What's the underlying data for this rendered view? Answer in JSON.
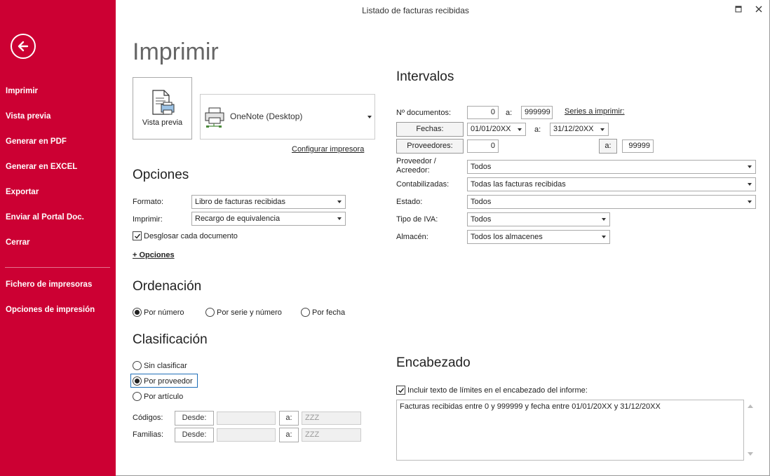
{
  "window": {
    "title": "Listado de facturas recibidas"
  },
  "sidebar": {
    "items": [
      {
        "label": "Imprimir"
      },
      {
        "label": "Vista previa"
      },
      {
        "label": "Generar en PDF"
      },
      {
        "label": "Generar en EXCEL"
      },
      {
        "label": "Exportar"
      },
      {
        "label": "Enviar al Portal Doc."
      },
      {
        "label": "Cerrar"
      },
      {
        "label": "Fichero de impresoras"
      },
      {
        "label": "Opciones de impresión"
      }
    ]
  },
  "page": {
    "title": "Imprimir"
  },
  "preview": {
    "label": "Vista previa"
  },
  "printer": {
    "name": "OneNote (Desktop)",
    "configure_link": "Configurar impresora"
  },
  "opciones": {
    "heading": "Opciones",
    "formato": {
      "label": "Formato:",
      "value": "Libro de facturas recibidas"
    },
    "imprimir": {
      "label": "Imprimir:",
      "value": "Recargo de equivalencia"
    },
    "desglosar": {
      "label": "Desglosar cada documento",
      "checked": true
    },
    "more_link": "+ Opciones"
  },
  "ordenacion": {
    "heading": "Ordenación",
    "options": [
      {
        "label": "Por número",
        "selected": true
      },
      {
        "label": "Por serie y número",
        "selected": false
      },
      {
        "label": "Por fecha",
        "selected": false
      }
    ]
  },
  "clasificacion": {
    "heading": "Clasificación",
    "options": [
      {
        "label": "Sin clasificar",
        "selected": false
      },
      {
        "label": "Por proveedor",
        "selected": true
      },
      {
        "label": "Por artículo",
        "selected": false
      }
    ],
    "codigos": {
      "label": "Códigos:",
      "desde": "Desde:",
      "a": "a:",
      "to_value": "ZZZ"
    },
    "familias": {
      "label": "Familias:",
      "desde": "Desde:",
      "a": "a:",
      "to_value": "ZZZ"
    }
  },
  "intervalos": {
    "heading": "Intervalos",
    "documentos": {
      "label": "Nº documentos:",
      "from": "0",
      "a": "a:",
      "to": "999999",
      "series_link": "Series a imprimir:"
    },
    "fechas": {
      "label": "Fechas:",
      "from": "01/01/20XX",
      "a": "a:",
      "to": "31/12/20XX"
    },
    "proveedores": {
      "label": "Proveedores:",
      "from": "0",
      "a": "a:",
      "to": "99999"
    },
    "proveedor_acreedor": {
      "label_line1": "Proveedor /",
      "label_line2": "Acreedor:",
      "value": "Todos"
    },
    "contabilizadas": {
      "label": "Contabilizadas:",
      "value": "Todas las facturas recibidas"
    },
    "estado": {
      "label": "Estado:",
      "value": "Todos"
    },
    "tipo_iva": {
      "label": "Tipo de IVA:",
      "value": "Todos"
    },
    "almacen": {
      "label": "Almacén:",
      "value": "Todos los almacenes"
    }
  },
  "encabezado": {
    "heading": "Encabezado",
    "include": {
      "label": "Incluir texto de límites en el encabezado del informe:",
      "checked": true
    },
    "text": "Facturas recibidas entre 0 y 999999 y fecha entre 01/01/20XX y 31/12/20XX"
  }
}
